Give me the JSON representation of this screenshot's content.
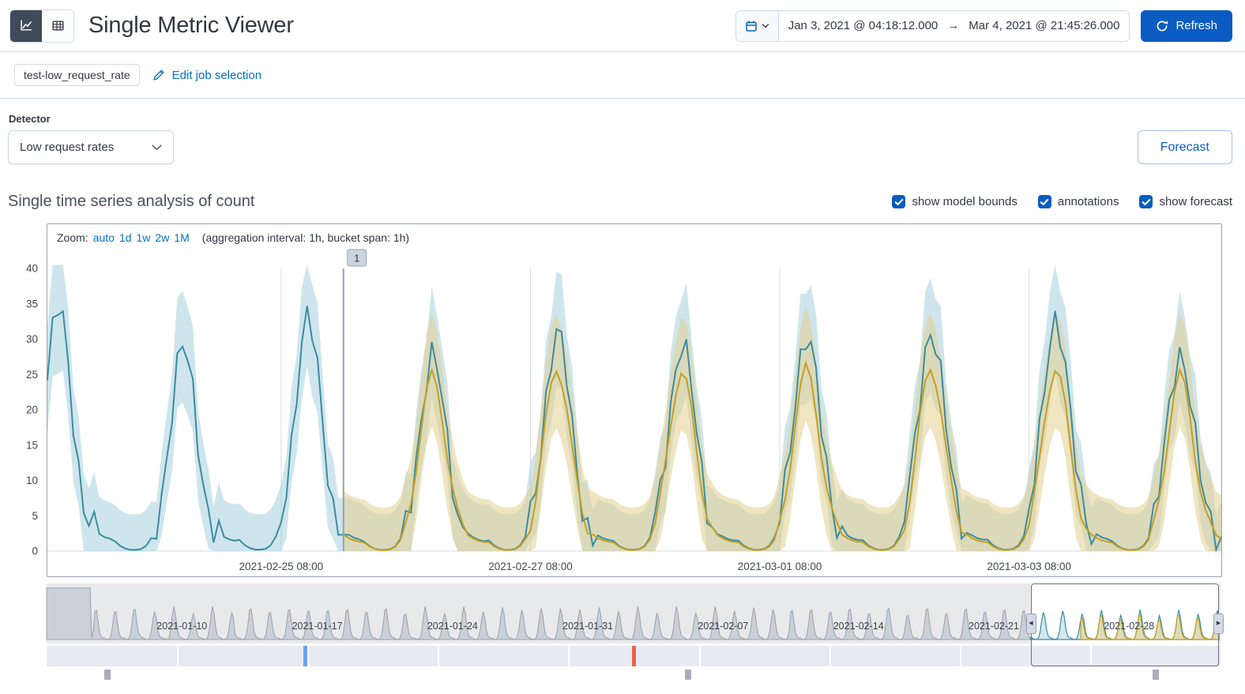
{
  "header": {
    "title": "Single Metric Viewer",
    "date_start": "Jan 3, 2021 @ 04:18:12.000",
    "date_arrow": "→",
    "date_end": "Mar 4, 2021 @ 21:45:26.000",
    "refresh_label": "Refresh"
  },
  "job": {
    "badge": "test-low_request_rate",
    "edit_link": "Edit job selection"
  },
  "detector": {
    "label": "Detector",
    "selected": "Low request rates"
  },
  "forecast_button_label": "Forecast",
  "analysis": {
    "heading": "Single time series analysis of count",
    "checkboxes": [
      {
        "label": "show model bounds",
        "checked": true
      },
      {
        "label": "annotations",
        "checked": true
      },
      {
        "label": "show forecast",
        "checked": true
      }
    ]
  },
  "chart_data": {
    "type": "line",
    "title": "Single time series analysis of count",
    "zoom_bar": {
      "label": "Zoom:",
      "links": [
        "auto",
        "1d",
        "1w",
        "2w",
        "1M"
      ],
      "info": "(aggregation interval: 1h, bucket span: 1h)"
    },
    "colors": {
      "actual_line": "#3a8ca1",
      "model_bounds": "#9fcbdb",
      "forecast_line": "#c79f1f",
      "forecast_bounds": "#e3cf8e",
      "gridline": "#d6dce6",
      "annotation": "#98a2b3"
    },
    "main": {
      "ylim": [
        0,
        40
      ],
      "yticks": [
        0,
        5,
        10,
        15,
        20,
        25,
        30,
        35,
        40
      ],
      "xticks": [
        {
          "label": "2021-02-25 08:00",
          "hour": 45
        },
        {
          "label": "2021-02-27 08:00",
          "hour": 93
        },
        {
          "label": "2021-03-01 08:00",
          "hour": 141
        },
        {
          "label": "2021-03-03 08:00",
          "hour": 189
        }
      ],
      "start_hour_of_day": 11,
      "total_hours": 226,
      "bucket_span_hours": 1,
      "annotation": {
        "label": "1",
        "hour": 57
      },
      "forecast_start_hour": 57,
      "daily_pattern_hourly": [
        1.5,
        0.8,
        0.4,
        0.2,
        0.2,
        0.3,
        0.8,
        2,
        4.5,
        9,
        15,
        22,
        28,
        31,
        29,
        24,
        17,
        11,
        6.5,
        4,
        2.8,
        2.2,
        1.8,
        1.6
      ],
      "day_peak_scale_actual": [
        1.1,
        0.92,
        1.05,
        0.88,
        1.0,
        0.95,
        1.0,
        1.02,
        1.08,
        0.92
      ],
      "day_peak_scale_forecast": [
        0,
        0,
        0.84,
        0.8,
        0.84,
        0.82,
        0.83,
        0.84,
        0.84,
        0.8
      ],
      "bounds_halfwidth": {
        "actual_base": 5,
        "actual_factor": 0.1,
        "forecast_base": 6,
        "forecast_factor": 0.08
      }
    },
    "context": {
      "total_days": 60.73,
      "xticks": [
        {
          "label": "2021-01-10",
          "day": 7
        },
        {
          "label": "2021-01-17",
          "day": 14
        },
        {
          "label": "2021-01-24",
          "day": 21
        },
        {
          "label": "2021-01-31",
          "day": 28
        },
        {
          "label": "2021-02-07",
          "day": 35
        },
        {
          "label": "2021-02-14",
          "day": 42
        },
        {
          "label": "2021-02-21",
          "day": 49
        },
        {
          "label": "2021-02-28",
          "day": 56
        }
      ],
      "selection_days": [
        50.9,
        60.65
      ],
      "forecast_start_day": 53.5,
      "initial_gap_days": 2.3,
      "swimlane_markers": [
        {
          "color": "#6c9ff2",
          "day": 13.3
        },
        {
          "color": "#e7664c",
          "day": 30.3
        }
      ],
      "annotation_ticks_days": [
        3.0,
        33.0,
        57.2
      ],
      "brush": {
        "left_arrow": "◀",
        "right_arrow": "▶"
      }
    }
  }
}
